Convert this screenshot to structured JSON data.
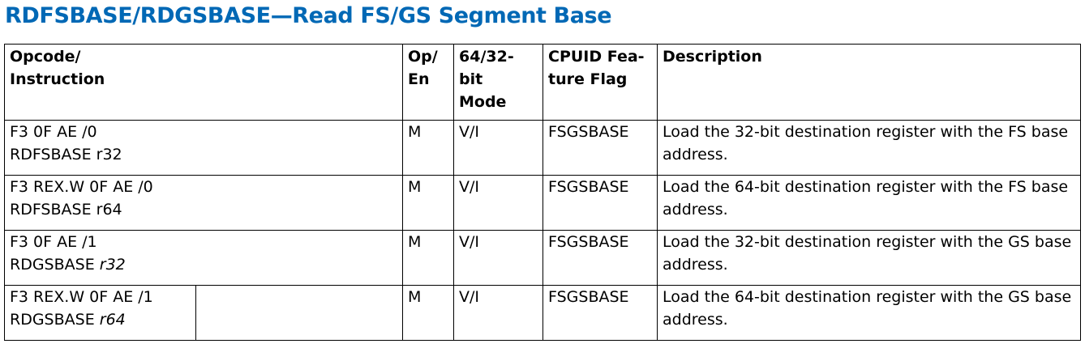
{
  "title": "RDFSBASE/RDGSBASE—Read FS/GS Segment Base",
  "headers": {
    "opcode_line1": "Opcode/",
    "opcode_line2": "Instruction",
    "open_line1": "Op/",
    "open_line2": "En",
    "mode_line1": "64/32-",
    "mode_line2": "bit",
    "mode_line3": "Mode",
    "cpuid_line1": "CPUID Fea-",
    "cpuid_line2": "ture Flag",
    "description": "Description"
  },
  "rows": [
    {
      "opcode": "F3 0F AE /0",
      "instruction_name": "RDFSBASE",
      "instruction_operand": "r32",
      "op_en": "M",
      "mode": "V/I",
      "cpuid": "FSGSBASE",
      "description": "Load the 32-bit destination register with the FS base address."
    },
    {
      "opcode": "F3 REX.W 0F AE /0",
      "instruction_name": "RDFSBASE",
      "instruction_operand": "r64",
      "op_en": "M",
      "mode": "V/I",
      "cpuid": "FSGSBASE",
      "description": "Load the 64-bit destination register with the FS base address."
    },
    {
      "opcode": "F3 0F AE /1",
      "instruction_name": "RDGSBASE",
      "instruction_operand": "r32",
      "op_en": "M",
      "mode": "V/I",
      "cpuid": "FSGSBASE",
      "description": "Load the 32-bit destination register with the GS base address."
    },
    {
      "opcode": "F3 REX.W 0F AE /1",
      "instruction_name": "RDGSBASE",
      "instruction_operand": "r64",
      "op_en": "M",
      "mode": "V/I",
      "cpuid": "FSGSBASE",
      "description": "Load the 64-bit destination register with the GS base address."
    }
  ],
  "colors": {
    "title": "#0068b5",
    "text": "#000000",
    "border": "#000000"
  }
}
